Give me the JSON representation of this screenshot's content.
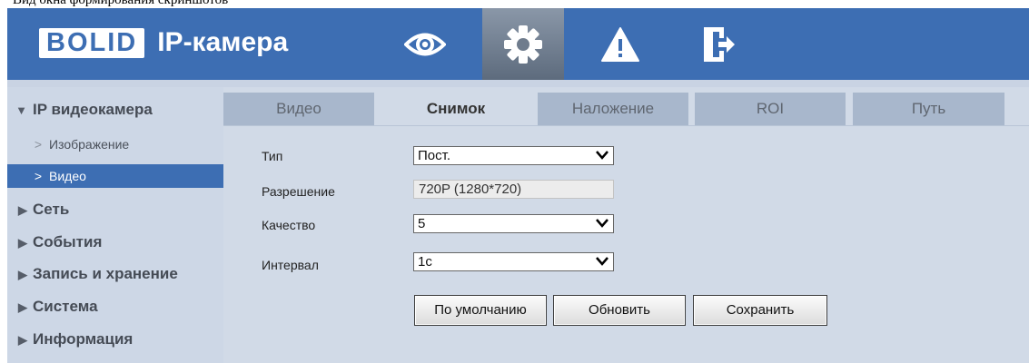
{
  "caption": "Вид окна формирования скриншотов",
  "header": {
    "logo_brand": "BOLID",
    "logo_text": "IP-камера",
    "icons": [
      "eye-icon",
      "gear-icon",
      "warning-icon",
      "exit-icon"
    ],
    "active_icon": "gear-icon"
  },
  "sidebar": {
    "section": "IP видеокамера",
    "items": [
      {
        "label": "Изображение",
        "active": false
      },
      {
        "label": "Видео",
        "active": true
      }
    ],
    "groups": [
      "Сеть",
      "События",
      "Запись и хранение",
      "Система",
      "Информация"
    ]
  },
  "tabs": [
    {
      "label": "Видео",
      "active": false
    },
    {
      "label": "Снимок",
      "active": true
    },
    {
      "label": "Наложение",
      "active": false
    },
    {
      "label": "ROI",
      "active": false
    },
    {
      "label": "Путь",
      "active": false
    }
  ],
  "form": {
    "type_label": "Тип",
    "type_value": "Пост.",
    "resolution_label": "Разрешение",
    "resolution_value": "720P (1280*720)",
    "quality_label": "Качество",
    "quality_value": "5",
    "interval_label": "Интервал",
    "interval_value": "1с"
  },
  "buttons": {
    "default": "По умолчанию",
    "refresh": "Обновить",
    "save": "Сохранить"
  },
  "colors": {
    "header_bg": "#3d6eb3",
    "sidebar_bg": "#cdd7e6",
    "content_bg": "#d1dae7",
    "tab_inactive": "#a8b7cc",
    "active_item": "#3d6eb3"
  }
}
